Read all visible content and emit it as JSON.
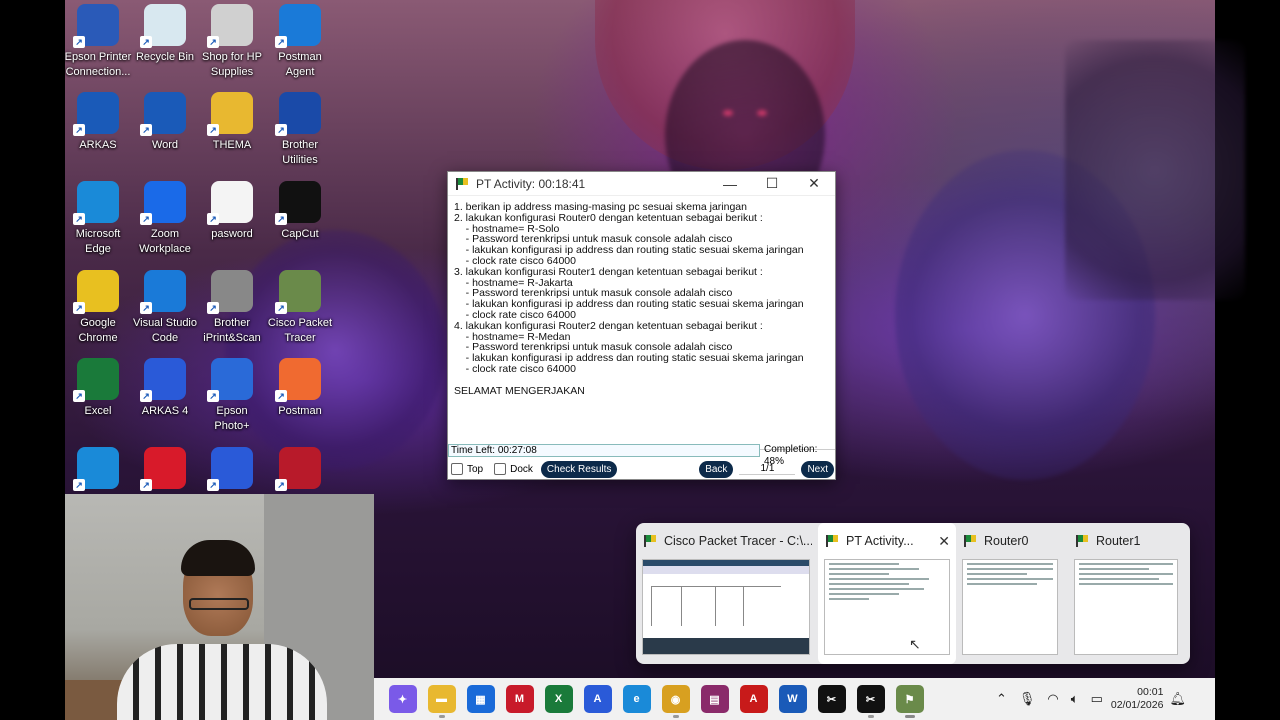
{
  "desktop_icons": [
    {
      "label": "Epson Printer Connection...",
      "icon": "epson-printer-icon",
      "color": "#2a5ab8"
    },
    {
      "label": "Recycle Bin",
      "icon": "recycle-bin-icon",
      "color": "#d8e8f0"
    },
    {
      "label": "Shop for HP Supplies",
      "icon": "hp-printer-icon",
      "color": "#d0d0d0"
    },
    {
      "label": "Postman Agent",
      "icon": "postman-agent-icon",
      "color": "#1a7ad8"
    },
    {
      "label": "ARKAS",
      "icon": "arkas-icon",
      "color": "#1a5ab8"
    },
    {
      "label": "Word",
      "icon": "word-icon",
      "color": "#1a5ab8"
    },
    {
      "label": "THEMA",
      "icon": "folder-icon",
      "color": "#e8b830"
    },
    {
      "label": "Brother Utilities",
      "icon": "brother-utilities-icon",
      "color": "#1a4aa8"
    },
    {
      "label": "Microsoft Edge",
      "icon": "edge-icon",
      "color": "#1a8ad8"
    },
    {
      "label": "Zoom Workplace",
      "icon": "zoom-icon",
      "color": "#1a6ae8"
    },
    {
      "label": "pasword",
      "icon": "text-file-icon",
      "color": "#f4f4f4"
    },
    {
      "label": "CapCut",
      "icon": "capcut-icon",
      "color": "#111111"
    },
    {
      "label": "Google Chrome",
      "icon": "chrome-icon",
      "color": "#e8c020"
    },
    {
      "label": "Visual Studio Code",
      "icon": "vscode-icon",
      "color": "#1a7ad8"
    },
    {
      "label": "Brother iPrint&Scan",
      "icon": "brother-iprint-icon",
      "color": "#888888"
    },
    {
      "label": "Cisco Packet Tracer",
      "icon": "cisco-packet-tracer-icon",
      "color": "#6a8a4a"
    },
    {
      "label": "Excel",
      "icon": "excel-icon",
      "color": "#1a7a3a"
    },
    {
      "label": "ARKAS 4",
      "icon": "arkas4-icon",
      "color": "#2a5ad8"
    },
    {
      "label": "Epson Photo+",
      "icon": "epson-photo-icon",
      "color": "#2a6ad8"
    },
    {
      "label": "Postman",
      "icon": "postman-icon",
      "color": "#f06a30"
    },
    {
      "label": "",
      "icon": "edge-icon",
      "color": "#1a8ad8"
    },
    {
      "label": "",
      "icon": "warning-app-icon",
      "color": "#d81a2a"
    },
    {
      "label": "",
      "icon": "add-user-app-icon",
      "color": "#2a5ad8"
    },
    {
      "label": "",
      "icon": "mendeley-icon",
      "color": "#b81a2a"
    }
  ],
  "pt_window": {
    "title": "PT Activity: 00:18:41",
    "instructions": [
      "1. berikan ip address masing-masing pc sesuai skema jaringan",
      "2. lakukan konfigurasi Router0 dengan ketentuan sebagai berikut :",
      "    - hostname= R-Solo",
      "    - Password terenkripsi untuk masuk console adalah cisco",
      "    - lakukan konfigurasi ip address dan routing static sesuai skema jaringan",
      "    - clock rate cisco 64000",
      "3. lakukan konfigurasi Router1 dengan ketentuan sebagai berikut :",
      "    - hostname= R-Jakarta",
      "    - Password terenkripsi untuk masuk console adalah cisco",
      "    - lakukan konfigurasi ip address dan routing static sesuai skema jaringan",
      "    - clock rate cisco 64000",
      "4. lakukan konfigurasi Router2 dengan ketentuan sebagai berikut :",
      "    - hostname= R-Medan",
      "    - Password terenkripsi untuk masuk console adalah cisco",
      "    - lakukan konfigurasi ip address dan routing static sesuai skema jaringan",
      "    - clock rate cisco 64000",
      "",
      "SELAMAT MENGERJAKAN"
    ],
    "time_left": "Time Left: 00:27:08",
    "completion": "Completion: 48%",
    "top_label": "Top",
    "dock_label": "Dock",
    "check_results_label": "Check Results",
    "back_label": "Back",
    "page_indicator": "1/1",
    "next_label": "Next"
  },
  "flyout": {
    "thumbnails": [
      {
        "title": "Cisco Packet Tracer - C:\\..."
      },
      {
        "title": "PT Activity..."
      },
      {
        "title": "Router0"
      },
      {
        "title": "Router1"
      }
    ]
  },
  "taskbar": {
    "apps": [
      {
        "name": "copilot-icon",
        "color": "#7a5ae8",
        "glyph": "✦"
      },
      {
        "name": "file-explorer-icon",
        "color": "#e8b830",
        "glyph": "▬"
      },
      {
        "name": "microsoft-store-icon",
        "color": "#1a6ad8",
        "glyph": "▦"
      },
      {
        "name": "mcafee-icon",
        "color": "#c81a2a",
        "glyph": "M"
      },
      {
        "name": "excel-icon",
        "color": "#1a7a3a",
        "glyph": "X"
      },
      {
        "name": "arkas-icon",
        "color": "#2a5ad8",
        "glyph": "A"
      },
      {
        "name": "edge-icon",
        "color": "#1a8ad8",
        "glyph": "e"
      },
      {
        "name": "chrome-icon",
        "color": "#d8a020",
        "glyph": "◉"
      },
      {
        "name": "winrar-icon",
        "color": "#8a2a6a",
        "glyph": "▤"
      },
      {
        "name": "acrobat-icon",
        "color": "#c81a1a",
        "glyph": "A"
      },
      {
        "name": "word-icon",
        "color": "#1a5ab8",
        "glyph": "W"
      },
      {
        "name": "capcut-icon",
        "color": "#111111",
        "glyph": "✂"
      },
      {
        "name": "capcut-icon-2",
        "color": "#111111",
        "glyph": "✂"
      },
      {
        "name": "cisco-packet-tracer-icon",
        "color": "#6a8a4a",
        "glyph": "⚑"
      }
    ],
    "clock_time": "00:01",
    "clock_date": "02/01/2026"
  }
}
